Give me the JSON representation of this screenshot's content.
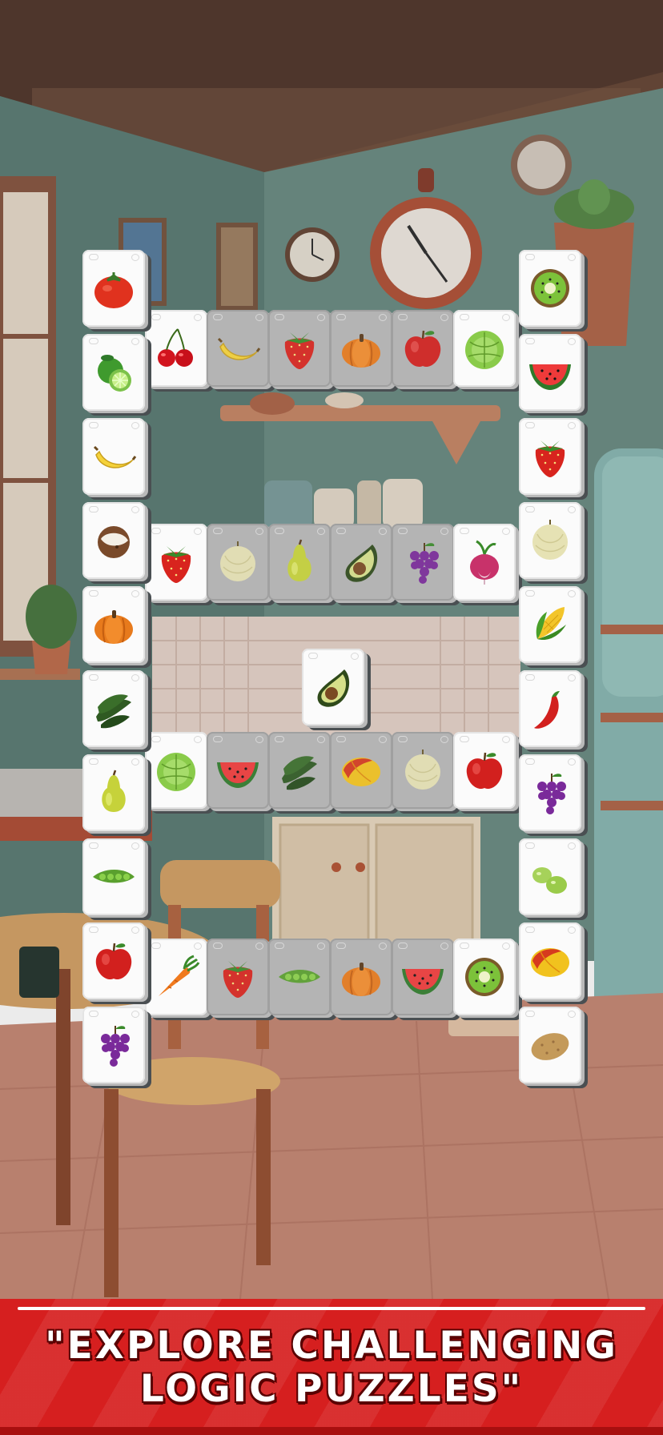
{
  "banner": {
    "line1": "\"EXPLORE CHALLENGING",
    "line2": "LOGIC PUZZLES\""
  },
  "colors": {
    "wall": "#6e8f86",
    "floor": "#c88b78",
    "banner": "#d61f1f",
    "tile_face": "#fbfbfb",
    "tile_blocked": "#b4b4b4"
  },
  "board": {
    "left_column": [
      "tomato",
      "lime",
      "banana",
      "coconut",
      "pumpkin",
      "cucumber",
      "pear",
      "peas",
      "apple",
      "grapes"
    ],
    "right_column": [
      "kiwi",
      "watermelon",
      "strawberry",
      "melon",
      "corn",
      "chili",
      "grapes",
      "green-grapes",
      "mango",
      "potato"
    ],
    "row_1": [
      "cherry",
      "banana",
      "strawberry",
      "pumpkin",
      "apple",
      "cabbage"
    ],
    "row_2": [
      "strawberry",
      "melon",
      "pear",
      "avocado",
      "grapes",
      "radish"
    ],
    "center": [
      "avocado"
    ],
    "row_3": [
      "cabbage",
      "watermelon",
      "cucumber",
      "mango",
      "melon",
      "apple"
    ],
    "row_4": [
      "carrot",
      "strawberry",
      "peas",
      "pumpkin",
      "watermelon",
      "kiwi"
    ]
  }
}
